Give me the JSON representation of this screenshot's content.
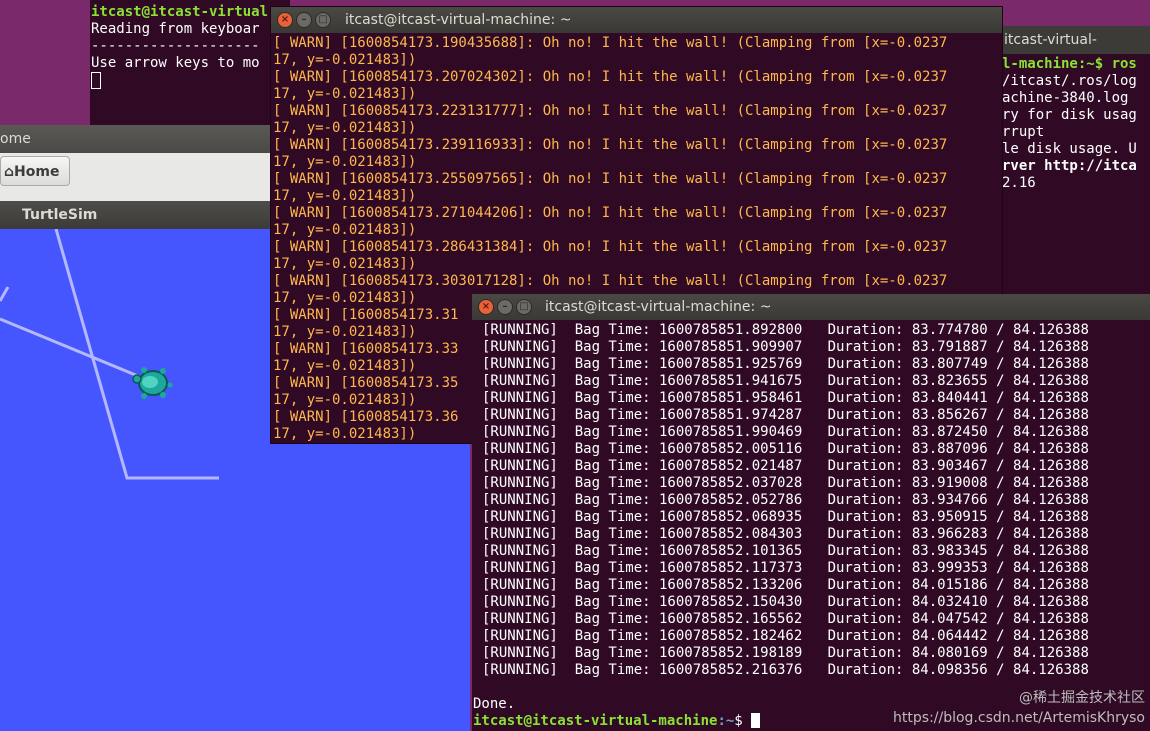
{
  "desktop": {
    "bg": "#7a2a6a"
  },
  "teleop": {
    "prompt_user": "itcast@itcast-virtual",
    "lines": [
      "Reading from keyboar",
      "--------------------",
      "Use arrow keys to mo"
    ]
  },
  "right_term": {
    "lines": [
      "l-machine:~$ ros",
      "/itcast/.ros/log",
      "achine-3840.log",
      "ry for disk usag",
      "rrupt",
      "le disk usage. U",
      "",
      "rver http://itca",
      "2.16"
    ]
  },
  "right_term_title": "itcast-virtual-machine",
  "file_browser": {
    "title": "ome",
    "home_label": "Home",
    "home_icon": "home-icon"
  },
  "turtlesim": {
    "title": "TurtleSim",
    "bg": "#4556ff",
    "pen_color": "#b3b8ff"
  },
  "warn_term": {
    "title": "itcast@itcast-virtual-machine: ~",
    "entries": [
      {
        "ts": "1600854173.190435688",
        "full": true
      },
      {
        "ts": "1600854173.207024302",
        "full": true
      },
      {
        "ts": "1600854173.223131777",
        "full": true
      },
      {
        "ts": "1600854173.239116933",
        "full": true
      },
      {
        "ts": "1600854173.255097565",
        "full": true
      },
      {
        "ts": "1600854173.271044206",
        "full": true
      },
      {
        "ts": "1600854173.286431384",
        "full": true
      },
      {
        "ts": "1600854173.303017128",
        "full": true
      },
      {
        "ts": "1600854173.31",
        "full": false
      },
      {
        "ts": "1600854173.33",
        "full": false
      },
      {
        "ts": "1600854173.35",
        "full": false
      },
      {
        "ts": "1600854173.36",
        "full": false
      }
    ],
    "prefix": "[ WARN] [",
    "msg": "]: Oh no! I hit the wall! (Clamping from [x=-0.0237",
    "cont": "17, y=-0.021483])"
  },
  "bag_term": {
    "title": "itcast@itcast-virtual-machine: ~",
    "total": "84.126388",
    "rows": [
      {
        "bag": "1600785851.892800",
        "dur": "83.774780"
      },
      {
        "bag": "1600785851.909907",
        "dur": "83.791887"
      },
      {
        "bag": "1600785851.925769",
        "dur": "83.807749"
      },
      {
        "bag": "1600785851.941675",
        "dur": "83.823655"
      },
      {
        "bag": "1600785851.958461",
        "dur": "83.840441"
      },
      {
        "bag": "1600785851.974287",
        "dur": "83.856267"
      },
      {
        "bag": "1600785851.990469",
        "dur": "83.872450"
      },
      {
        "bag": "1600785852.005116",
        "dur": "83.887096"
      },
      {
        "bag": "1600785852.021487",
        "dur": "83.903467"
      },
      {
        "bag": "1600785852.037028",
        "dur": "83.919008"
      },
      {
        "bag": "1600785852.052786",
        "dur": "83.934766"
      },
      {
        "bag": "1600785852.068935",
        "dur": "83.950915"
      },
      {
        "bag": "1600785852.084303",
        "dur": "83.966283"
      },
      {
        "bag": "1600785852.101365",
        "dur": "83.983345"
      },
      {
        "bag": "1600785852.117373",
        "dur": "83.999353"
      },
      {
        "bag": "1600785852.133206",
        "dur": "84.015186"
      },
      {
        "bag": "1600785852.150430",
        "dur": "84.032410"
      },
      {
        "bag": "1600785852.165562",
        "dur": "84.047542"
      },
      {
        "bag": "1600785852.182462",
        "dur": "84.064442"
      },
      {
        "bag": "1600785852.198189",
        "dur": "84.080169"
      },
      {
        "bag": "1600785852.216376",
        "dur": "84.098356"
      }
    ],
    "done": "Done.",
    "prompt_user": "itcast@itcast-virtual-machine",
    "prompt_path": ":~",
    "prompt_end": "$ "
  },
  "watermark": {
    "line1": "@稀土掘金技术社区",
    "line2": "https://blog.csdn.net/ArtemisKhryso"
  }
}
